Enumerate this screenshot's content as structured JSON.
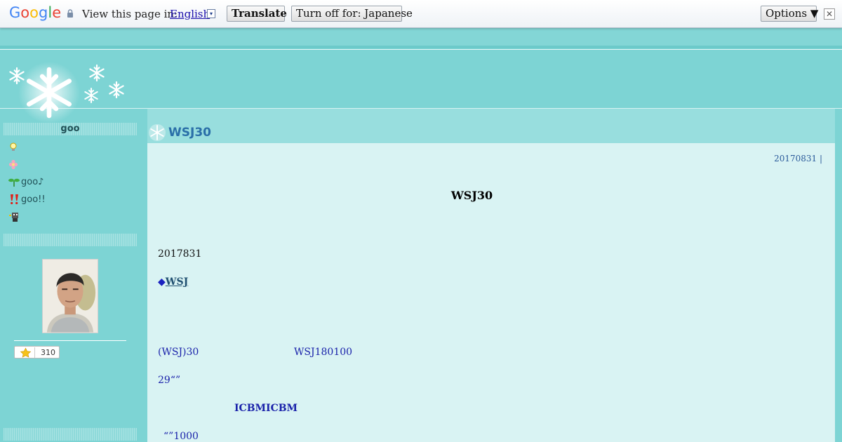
{
  "translate_bar": {
    "logo_letters": [
      {
        "ch": "G",
        "color": "#4285F4"
      },
      {
        "ch": "o",
        "color": "#EA4335"
      },
      {
        "ch": "o",
        "color": "#FBBC05"
      },
      {
        "ch": "g",
        "color": "#4285F4"
      },
      {
        "ch": "l",
        "color": "#34A853"
      },
      {
        "ch": "e",
        "color": "#EA4335"
      }
    ],
    "view_label": "View this page in:",
    "language": "English",
    "language_arrow": "▾",
    "translate_button": "Translate",
    "turn_off_button": "Turn off for: Japanese",
    "options_button": "Options ▼",
    "close_glyph": "✕"
  },
  "sidebar": {
    "title": "goo",
    "items": [
      {
        "icon": "lightbulb-icon",
        "label": ""
      },
      {
        "icon": "flower-icon",
        "label": ""
      },
      {
        "icon": "sprout-icon",
        "label": "goo♪"
      },
      {
        "icon": "double-exclamation-icon",
        "label": "goo!!"
      },
      {
        "icon": "robot-icon",
        "label": ""
      }
    ],
    "star_count": "310"
  },
  "entry": {
    "title": "WSJ30",
    "date": "20170831 |",
    "heading": "WSJ30",
    "lines": {
      "date_line": "2017831",
      "link_diamond": "◆",
      "link_text": "WSJ",
      "wsj30": "(WSJ)30",
      "wsj180": "WSJ180100",
      "line29": "29“”",
      "icbm": "ICBMICBM",
      "line1000": "“”1000"
    }
  },
  "colors": {
    "background": "#7dd4d4",
    "content": "#d9f3f3",
    "title_blue": "#2a6fa8",
    "text_blue": "#1a22aa"
  }
}
